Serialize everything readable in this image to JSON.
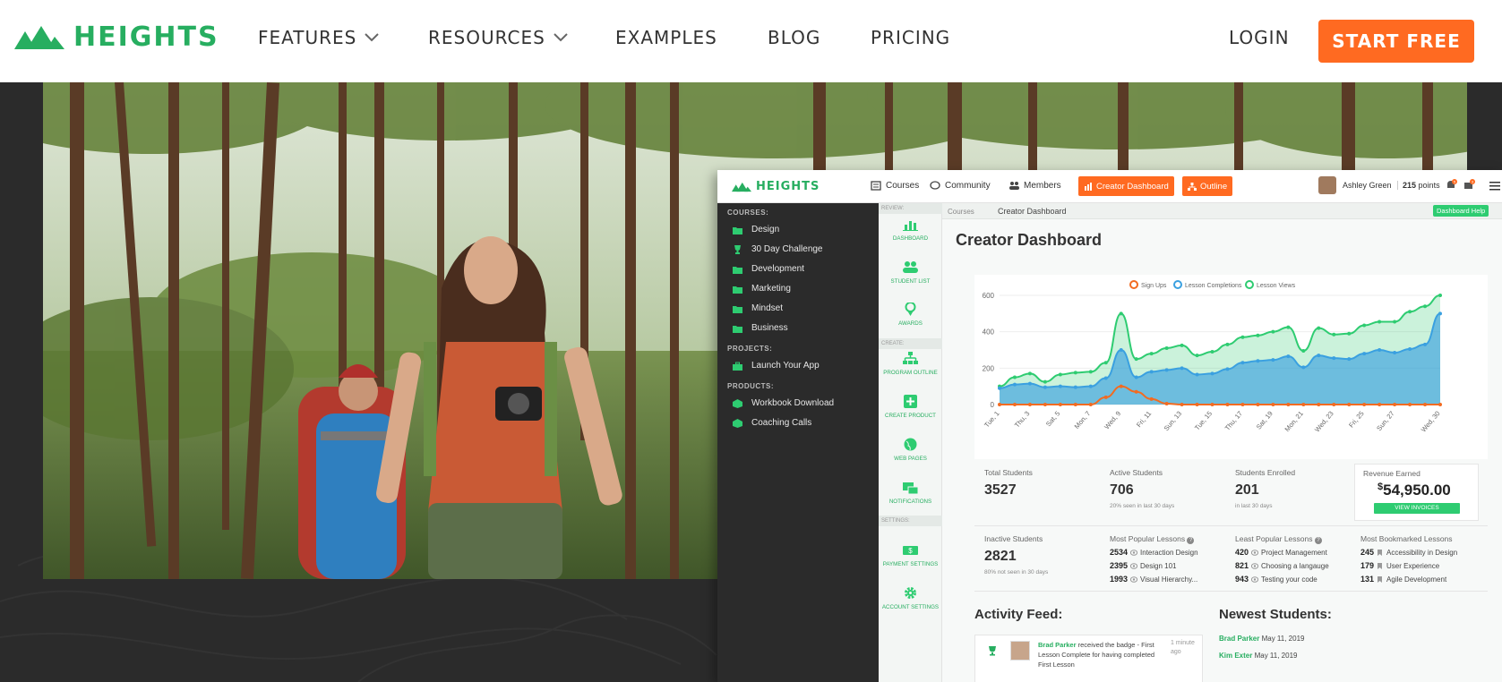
{
  "site": {
    "brand": "HEIGHTS",
    "brand_color": "#27ae60",
    "accent_color": "#ff6a21",
    "nav": [
      {
        "label": "FEATURES",
        "has_dropdown": true
      },
      {
        "label": "RESOURCES",
        "has_dropdown": true
      },
      {
        "label": "EXAMPLES",
        "has_dropdown": false
      },
      {
        "label": "BLOG",
        "has_dropdown": false
      },
      {
        "label": "PRICING",
        "has_dropdown": false
      }
    ],
    "login_label": "LOGIN",
    "cta_label": "START FREE"
  },
  "dashboard": {
    "brand": "HEIGHTS",
    "top_nav": [
      {
        "label": "Courses",
        "icon": "book-icon"
      },
      {
        "label": "Community",
        "icon": "chat-icon"
      },
      {
        "label": "Members",
        "icon": "people-icon"
      }
    ],
    "creator_btn": "Creator Dashboard",
    "outline_btn": "Outline",
    "user_name": "Ashley Green",
    "points_value": "215",
    "points_unit": "points",
    "notif_count_1": "5",
    "notif_count_2": "3",
    "sidebar": {
      "courses_heading": "COURSES:",
      "courses": [
        {
          "label": "Design",
          "icon": "folder-icon"
        },
        {
          "label": "30 Day Challenge",
          "icon": "trophy-icon"
        },
        {
          "label": "Development",
          "icon": "folder-icon"
        },
        {
          "label": "Marketing",
          "icon": "folder-icon"
        },
        {
          "label": "Mindset",
          "icon": "folder-icon"
        },
        {
          "label": "Business",
          "icon": "folder-icon"
        }
      ],
      "projects_heading": "PROJECTS:",
      "projects": [
        {
          "label": "Launch Your App",
          "icon": "briefcase-icon"
        }
      ],
      "products_heading": "PRODUCTS:",
      "products": [
        {
          "label": "Workbook Download",
          "icon": "cube-icon"
        },
        {
          "label": "Coaching Calls",
          "icon": "cube-icon"
        }
      ]
    },
    "icon_column": {
      "review_heading": "REVIEW:",
      "create_heading": "CREATE:",
      "settings_heading": "SETTINGS:",
      "items": [
        {
          "label": "DASHBOARD",
          "icon": "bar-chart-icon"
        },
        {
          "label": "STUDENT LIST",
          "icon": "users-icon"
        },
        {
          "label": "AWARDS",
          "icon": "award-icon"
        },
        {
          "label": "PROGRAM OUTLINE",
          "icon": "sitemap-icon"
        },
        {
          "label": "CREATE PRODUCT",
          "icon": "plus-square-icon"
        },
        {
          "label": "WEB PAGES",
          "icon": "globe-icon"
        },
        {
          "label": "NOTIFICATIONS",
          "icon": "notifications-icon"
        },
        {
          "label": "PAYMENT SETTINGS",
          "icon": "money-icon"
        },
        {
          "label": "ACCOUNT SETTINGS",
          "icon": "cog-icon"
        }
      ]
    },
    "breadcrumb_root": "Courses",
    "breadcrumb_current": "Creator Dashboard",
    "help_label": "Dashboard Help",
    "title": "Creator Dashboard",
    "stats_row1": [
      {
        "label": "Total Students",
        "value": "3527",
        "sub": ""
      },
      {
        "label": "Active Students",
        "value": "706",
        "sub": "20% seen in last 30 days"
      },
      {
        "label": "Students Enrolled",
        "value": "201",
        "sub": "in last 30 days"
      }
    ],
    "revenue": {
      "label": "Revenue Earned",
      "currency": "$",
      "value": "54,950.00",
      "button": "VIEW INVOICES"
    },
    "inactive": {
      "label": "Inactive Students",
      "value": "2821",
      "sub": "80% not seen in 30 days"
    },
    "popular": {
      "label": "Most Popular Lessons",
      "items": [
        {
          "count": "2534",
          "name": "Interaction Design"
        },
        {
          "count": "2395",
          "name": "Design 101"
        },
        {
          "count": "1993",
          "name": "Visual Hierarchy..."
        }
      ]
    },
    "least_popular": {
      "label": "Least Popular Lessons",
      "items": [
        {
          "count": "420",
          "name": "Project Management"
        },
        {
          "count": "821",
          "name": "Choosing a langauge"
        },
        {
          "count": "943",
          "name": "Testing your code"
        }
      ]
    },
    "bookmarked": {
      "label": "Most Bookmarked Lessons",
      "items": [
        {
          "count": "245",
          "name": "Accessibility in Design"
        },
        {
          "count": "179",
          "name": "User Experience"
        },
        {
          "count": "131",
          "name": "Agile Development"
        }
      ]
    },
    "activity_heading": "Activity Feed:",
    "activity": {
      "name": "Brad Parker",
      "text": "received the badge - First Lesson Complete for having completed",
      "text_cont": "First Lesson",
      "time_1": "1 minute",
      "time_2": "ago"
    },
    "newest_heading": "Newest Students:",
    "newest": [
      {
        "name": "Brad Parker",
        "date": "May 11, 2019"
      },
      {
        "name": "Kim Exter",
        "date": "May 11, 2019"
      }
    ]
  },
  "chart_data": {
    "type": "line",
    "title": "",
    "legend_position": "top",
    "x": [
      "Tue, 1",
      "Wed, 2",
      "Thu, 3",
      "Fri, 4",
      "Sat, 5",
      "Sun, 6",
      "Mon, 7",
      "Tue, 8",
      "Wed, 9",
      "Thu, 10",
      "Fri, 11",
      "Sat, 12",
      "Sun, 13",
      "Mon, 14",
      "Tue, 15",
      "Wed, 16",
      "Thu, 17",
      "Fri, 18",
      "Sat, 19",
      "Sun, 20",
      "Mon, 21",
      "Tue, 22",
      "Wed, 23",
      "Thu, 24",
      "Fri, 25",
      "Sat, 26",
      "Sun, 27",
      "Mon, 28",
      "Tue, 29",
      "Wed, 30"
    ],
    "x_tick_labels": [
      "Tue, 1",
      "Thu, 3",
      "Sat, 5",
      "Mon, 7",
      "Wed, 9",
      "Fri, 11",
      "Sun, 13",
      "Tue, 15",
      "Thu, 17",
      "Sat, 19",
      "Mon, 21",
      "Wed, 23",
      "Fri, 25",
      "Sun, 27",
      "Wed, 30"
    ],
    "ylim": [
      0,
      600
    ],
    "yticks": [
      "0",
      "200",
      "400",
      "600"
    ],
    "series": [
      {
        "name": "Sign Ups",
        "color": "#f26b21",
        "values": [
          0,
          0,
          0,
          0,
          0,
          0,
          0,
          40,
          100,
          70,
          30,
          5,
          0,
          0,
          0,
          0,
          0,
          0,
          0,
          0,
          0,
          0,
          0,
          0,
          0,
          0,
          0,
          0,
          0,
          0
        ]
      },
      {
        "name": "Lesson Completions",
        "color": "#3aa0e0",
        "values": [
          90,
          110,
          115,
          95,
          100,
          95,
          100,
          145,
          300,
          150,
          180,
          190,
          200,
          165,
          170,
          195,
          230,
          240,
          245,
          265,
          205,
          270,
          255,
          250,
          280,
          300,
          285,
          305,
          330,
          500
        ]
      },
      {
        "name": "Lesson Views",
        "color": "#2ecc71",
        "values": [
          100,
          150,
          170,
          125,
          165,
          175,
          180,
          230,
          500,
          250,
          280,
          310,
          325,
          270,
          290,
          330,
          370,
          380,
          400,
          425,
          295,
          420,
          385,
          390,
          435,
          455,
          455,
          510,
          540,
          600
        ]
      }
    ]
  }
}
